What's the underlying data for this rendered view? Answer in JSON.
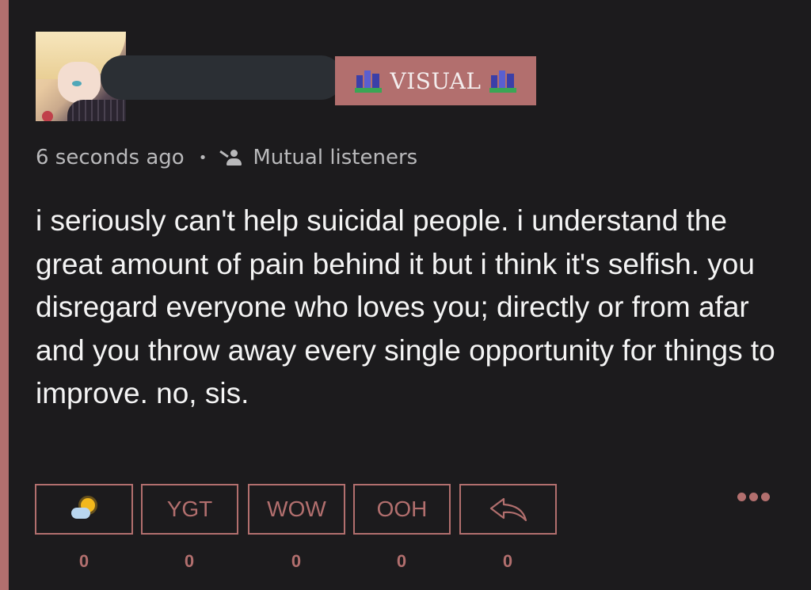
{
  "post": {
    "author_badge": "VISUAL",
    "timestamp": "6 seconds ago",
    "separator": "•",
    "audience": "Mutual listeners",
    "text": "i seriously can't help suicidal people. i understand the great amount of pain behind it but i think it's selfish. you disregard everyone who loves you; directly or from afar and you throw away every single opportunity for things to improve. no, sis."
  },
  "reactions": [
    {
      "icon": "sun-behind-cloud-icon",
      "label": "",
      "count": "0"
    },
    {
      "label": "YGT",
      "count": "0"
    },
    {
      "label": "WOW",
      "count": "0"
    },
    {
      "label": "OOH",
      "count": "0"
    },
    {
      "icon": "reply-arrow-icon",
      "label": "",
      "count": "0"
    }
  ],
  "colors": {
    "background": "#1c1b1d",
    "accent": "#b26f6e",
    "text": "#f4f4f4",
    "muted": "#b9b9bb"
  }
}
